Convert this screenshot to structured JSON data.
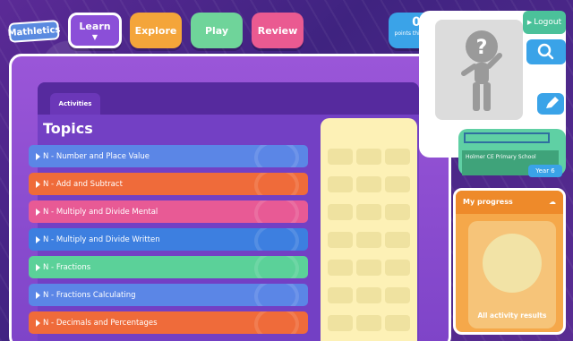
{
  "app": {
    "logo_text": "Mathletics"
  },
  "nav": {
    "learn": "Learn",
    "explore": "Explore",
    "play": "Play",
    "review": "Review",
    "points_value": "0",
    "points_label": "points this week"
  },
  "main": {
    "tab_label": "Activities",
    "title": "Topics",
    "rows": [
      {
        "label": "N - Number and Place Value",
        "color": "#5b86e6"
      },
      {
        "label": "N - Add and Subtract",
        "color": "#ef6b3a"
      },
      {
        "label": "N - Multiply and Divide Mental",
        "color": "#e85a95"
      },
      {
        "label": "N - Multiply and Divide Written",
        "color": "#3d7fe0"
      },
      {
        "label": "N - Fractions",
        "color": "#5bd199"
      },
      {
        "label": "N - Fractions Calculating",
        "color": "#5b86e6"
      },
      {
        "label": "N - Decimals and Percentages",
        "color": "#ef6b3a"
      }
    ]
  },
  "profile": {
    "logout_label": "Logout",
    "school_name": "Holmer CE Primary School",
    "year": "Year 6",
    "search_icon": "search-icon",
    "edit_icon": "pencil-icon"
  },
  "progress": {
    "title": "My progress",
    "caption": "All activity results"
  },
  "colors": {
    "accent": "#8b4fd8",
    "explore": "#f4a53a",
    "play": "#6fd49a",
    "review": "#ea5a91"
  }
}
